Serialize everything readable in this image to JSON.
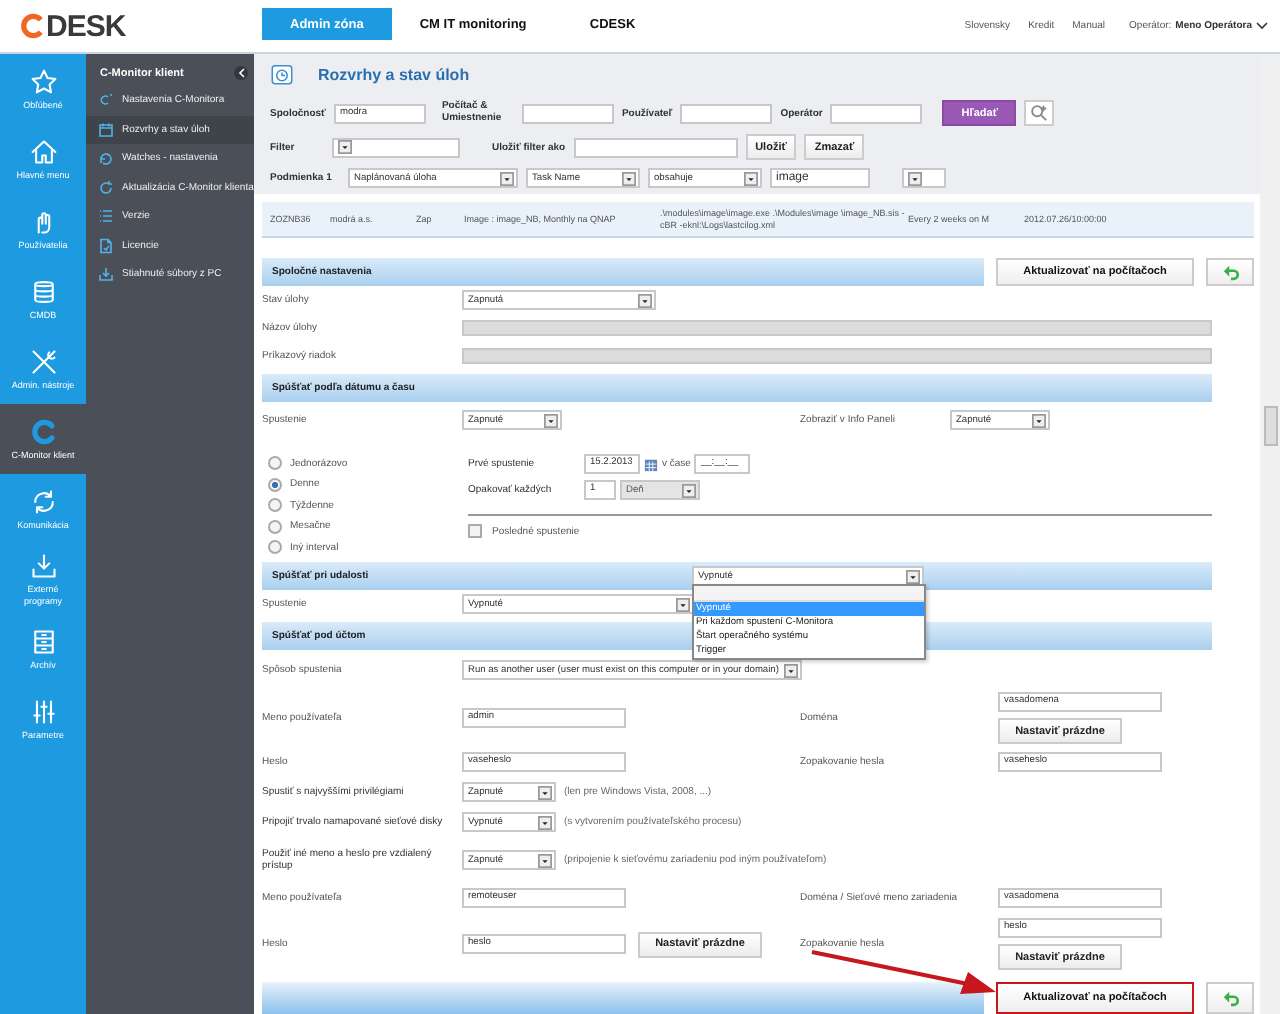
{
  "header": {
    "logo": "DESK",
    "tabs": [
      {
        "label": "Admin zóna",
        "selected": true
      },
      {
        "label": "CM IT monitoring",
        "selected": false
      },
      {
        "label": "CDESK",
        "selected": false
      }
    ],
    "links": [
      "Slovensky",
      "Kredit",
      "Manual"
    ],
    "operator_label": "Operátor:",
    "operator_name": "Meno Operátora"
  },
  "rail": [
    {
      "label": "Obľúbené",
      "selected": false
    },
    {
      "label": "Hlavné menu",
      "selected": false
    },
    {
      "label": "Používatelia",
      "selected": false
    },
    {
      "label": "CMDB",
      "selected": false
    },
    {
      "label": "Admin. nástroje",
      "selected": false
    },
    {
      "label": "C-Monitor klient",
      "selected": true
    },
    {
      "label": "Komunikácia",
      "selected": false
    },
    {
      "label": "Externé programy",
      "selected": false
    },
    {
      "label": "Archív",
      "selected": false
    },
    {
      "label": "Parametre",
      "selected": false
    }
  ],
  "submenu": {
    "title": "C-Monitor klient",
    "items": [
      {
        "label": "Nastavenia C-Monitora",
        "selected": false
      },
      {
        "label": "Rozvrhy a stav úloh",
        "selected": true
      },
      {
        "label": "Watches - nastavenia",
        "selected": false
      },
      {
        "label": "Aktualizácia C-Monitor klienta",
        "selected": false
      },
      {
        "label": "Verzie",
        "selected": false
      },
      {
        "label": "Licencie",
        "selected": false
      },
      {
        "label": "Stiahnuté súbory z PC",
        "selected": false
      }
    ]
  },
  "page": {
    "title": "Rozvrhy a stav úloh"
  },
  "filter": {
    "fields": [
      {
        "label": "Spoločnosť",
        "value": "modra"
      },
      {
        "label": "Počítač & Umiestnenie"
      },
      {
        "label": "Používateľ"
      },
      {
        "label": "Operátor"
      }
    ],
    "search_button": "Hľadať",
    "filter_label": "Filter",
    "save_as_label": "Uložiť filter ako",
    "buttons": [
      "Uložiť",
      "Zmazať"
    ],
    "condition_label": "Podmienka 1",
    "condition_selects": [
      "Naplánovaná úloha",
      "Task Name",
      "obsahuje"
    ],
    "condition_value": "image"
  },
  "results": {
    "rows": [
      {
        "cells": [
          "ZOZNB36",
          "modrá a.s.",
          "Zap",
          "Image : image_NB, Monthly na QNAP",
          ".\\modules\\image\\image.exe .\\Modules\\image \\image_NB.sis -cBR -eknl:\\Logs\\lastcilog.xml",
          "Every 2 weeks on M",
          "2012.07.26/10:00:00"
        ]
      }
    ]
  },
  "common": {
    "title": "Spoločné nastavenia",
    "update_button": "Aktualizovať na počítačoch",
    "state_label": "Stav úlohy",
    "state_value": "Zapnutá",
    "name_label": "Názov úlohy",
    "command_label": "Príkazový riadok"
  },
  "schedule": {
    "title": "Spúšťať podľa dátumu a času",
    "run_label": "Spustenie",
    "run_value": "Zapnuté",
    "info_label": "Zobraziť v Info Paneli",
    "info_value": "Zapnuté",
    "intervals": [
      {
        "label": "Jednorázovo",
        "selected": false
      },
      {
        "label": "Denne",
        "selected": true
      },
      {
        "label": "Týždenne",
        "selected": false
      },
      {
        "label": "Mesačne",
        "selected": false
      },
      {
        "label": "Iný interval",
        "selected": false
      }
    ],
    "first_label": "Prvé spustenie",
    "date": "15.2.2013",
    "time_label": "v čase",
    "time": "__:__:__",
    "repeat_label": "Opakovať každých",
    "repeat_count": "1",
    "repeat_unit": {
      "value": "Deň",
      "disabled": true
    },
    "last_run": {
      "label": "Posledné spustenie",
      "checked": false
    }
  },
  "event": {
    "title": "Spúšťať pri udalosti",
    "value": "Vypnuté",
    "expanded": true,
    "options": [
      {
        "label": "Vypnuté",
        "selected": true
      },
      {
        "label": "Pri každom spustení C-Monitora",
        "selected": false
      },
      {
        "label": "Štart operačného systému",
        "selected": false
      },
      {
        "label": "Trigger",
        "selected": false
      }
    ],
    "run_label": "Spustenie",
    "run_value": "Vypnuté"
  },
  "account": {
    "title": "Spúšťať pod účtom",
    "rows": [
      {
        "kind": "select",
        "label": "Spôsob spustenia",
        "value": "Run as another user (user must exist on this computer or in your domain)"
      },
      {
        "kind": "field",
        "label": "Meno používateľa",
        "value": "admin",
        "right": {
          "label": "Doména",
          "value": "vasadomena",
          "button": "Nastaviť prázdne"
        }
      },
      {
        "kind": "field",
        "label": "Heslo",
        "value": "vaseheslo",
        "right": {
          "label": "Zopakovanie hesla",
          "value": "vaseheslo"
        }
      },
      {
        "kind": "select",
        "label": "Spustiť s najvyššími privilégiami",
        "value": "Zapnuté",
        "note": "(len pre Windows Vista, 2008, ...)"
      },
      {
        "kind": "select",
        "label": "Pripojiť trvalo namapované sieťové disky",
        "value": "Vypnuté",
        "note": "(s vytvorením používateľského procesu)"
      },
      {
        "kind": "select",
        "label": "Použiť iné meno a heslo pre vzdialený prístup",
        "value": "Zapnuté",
        "note": "(pripojenie k sieťovému zariadeniu pod iným používateľom)"
      },
      {
        "kind": "field",
        "label": "Meno používateľa",
        "value": "remoteuser",
        "right": {
          "label": "Doména / Sieťové meno zariadenia",
          "value": "vasadomena"
        }
      },
      {
        "kind": "field",
        "label": "Heslo",
        "value": "heslo",
        "button": "Nastaviť prázdne",
        "right": {
          "label": "Zopakovanie hesla",
          "value": "heslo",
          "button": "Nastaviť prázdne"
        }
      }
    ]
  },
  "footer": {
    "update_button": "Aktualizovať na počítačoch",
    "highlighted": true
  }
}
